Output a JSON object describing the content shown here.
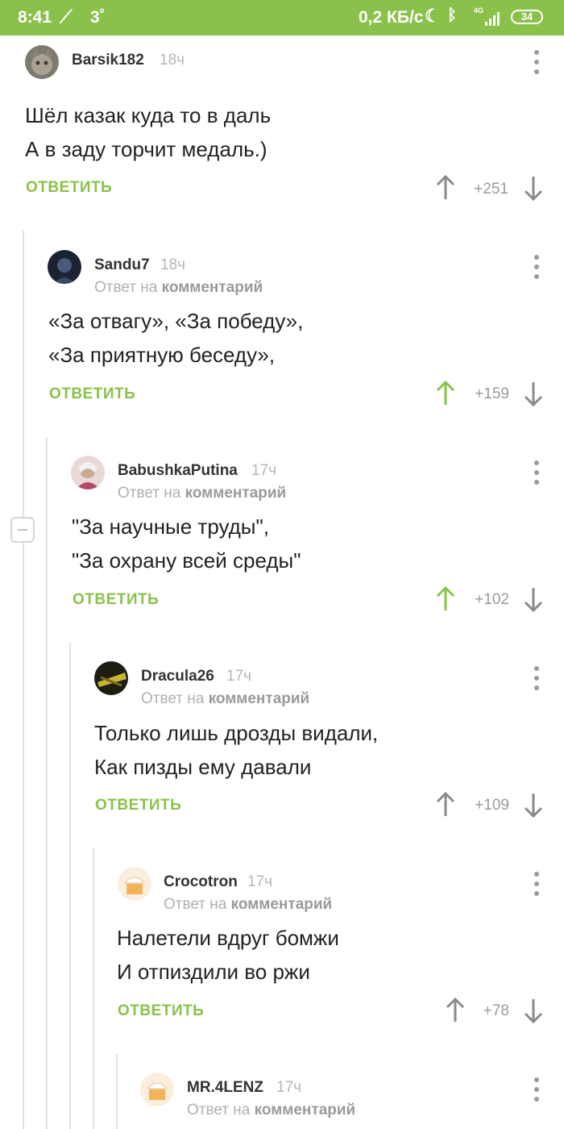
{
  "status_bar": {
    "time": "8:41",
    "temperature": "3˚",
    "speed": "0,2 КБ/с",
    "network": "4G",
    "battery": "34",
    "accent_color": "#8ac14a"
  },
  "comments": [
    {
      "author": "Barsik182",
      "time": "18ч",
      "reply_to": "",
      "lines": [
        "Шёл казак куда то в даль",
        "А в заду торчит медаль.)"
      ],
      "reply_label": "ОТВЕТИТЬ",
      "score": "+251",
      "upvoted": false
    },
    {
      "author": "Sandu7",
      "time": "18ч",
      "reply_to": "Ответ на",
      "reply_to_target": "комментарий",
      "lines": [
        "«За отвагу», «За победу»,",
        "«За приятную беседу»,"
      ],
      "reply_label": "ОТВЕТИТЬ",
      "score": "+159",
      "upvoted": true
    },
    {
      "author": "BabushkaPutina",
      "time": "17ч",
      "reply_to": "Ответ на",
      "reply_to_target": "комментарий",
      "lines": [
        "\"За научные труды\",",
        "\"За охрану всей среды\""
      ],
      "reply_label": "ОТВЕТИТЬ",
      "score": "+102",
      "upvoted": true
    },
    {
      "author": "Dracula26",
      "time": "17ч",
      "reply_to": "Ответ на",
      "reply_to_target": "комментарий",
      "lines": [
        "Только лишь дрозды видали,",
        "Как пизды ему давали"
      ],
      "reply_label": "ОТВЕТИТЬ",
      "score": "+109",
      "upvoted": false
    },
    {
      "author": "Crocotron",
      "time": "17ч",
      "reply_to": "Ответ на",
      "reply_to_target": "комментарий",
      "lines": [
        "Налетели вдруг бомжи",
        "И отпиздили во ржи"
      ],
      "reply_label": "ОТВЕТИТЬ",
      "score": "+78",
      "upvoted": false
    },
    {
      "author": "MR.4LENZ",
      "time": "17ч",
      "reply_to": "Ответ на",
      "reply_to_target": "комментарий"
    }
  ]
}
